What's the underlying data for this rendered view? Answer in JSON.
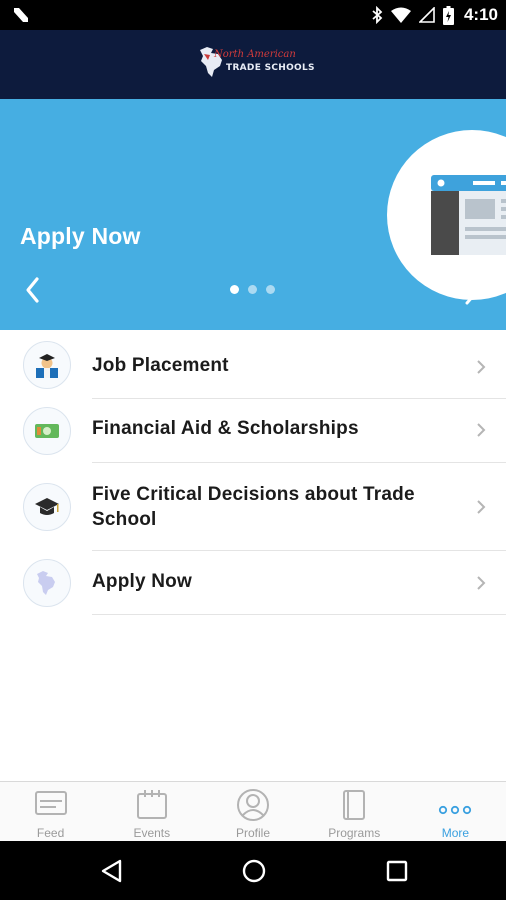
{
  "status_bar": {
    "time": "4:10",
    "icons": [
      "n-icon",
      "bluetooth-icon",
      "wifi-icon",
      "signal-icon",
      "battery-icon"
    ]
  },
  "header": {
    "logo_line1": "North American",
    "logo_line2": "TRADE SCHOOLS"
  },
  "banner": {
    "title": "Apply Now",
    "slide_count": 3,
    "active_slide": 1
  },
  "list": {
    "items": [
      {
        "label": "Job Placement",
        "icon": "graduate-icon"
      },
      {
        "label": "Financial Aid & Scholarships",
        "icon": "money-icon"
      },
      {
        "label": "Five Critical Decisions about Trade School",
        "icon": "graduation-cap-icon"
      },
      {
        "label": "Apply Now",
        "icon": "north-america-map-icon"
      }
    ]
  },
  "tabs": [
    {
      "label": "Feed",
      "icon": "feed-icon",
      "active": false
    },
    {
      "label": "Events",
      "icon": "calendar-icon",
      "active": false
    },
    {
      "label": "Profile",
      "icon": "profile-icon",
      "active": false
    },
    {
      "label": "Programs",
      "icon": "book-icon",
      "active": false
    },
    {
      "label": "More",
      "icon": "more-dots-icon",
      "active": true
    }
  ],
  "colors": {
    "header_bg": "#0d1b3d",
    "banner_bg": "#46aee2",
    "accent": "#3aa0e0",
    "tab_inactive": "#9a9a9a"
  }
}
